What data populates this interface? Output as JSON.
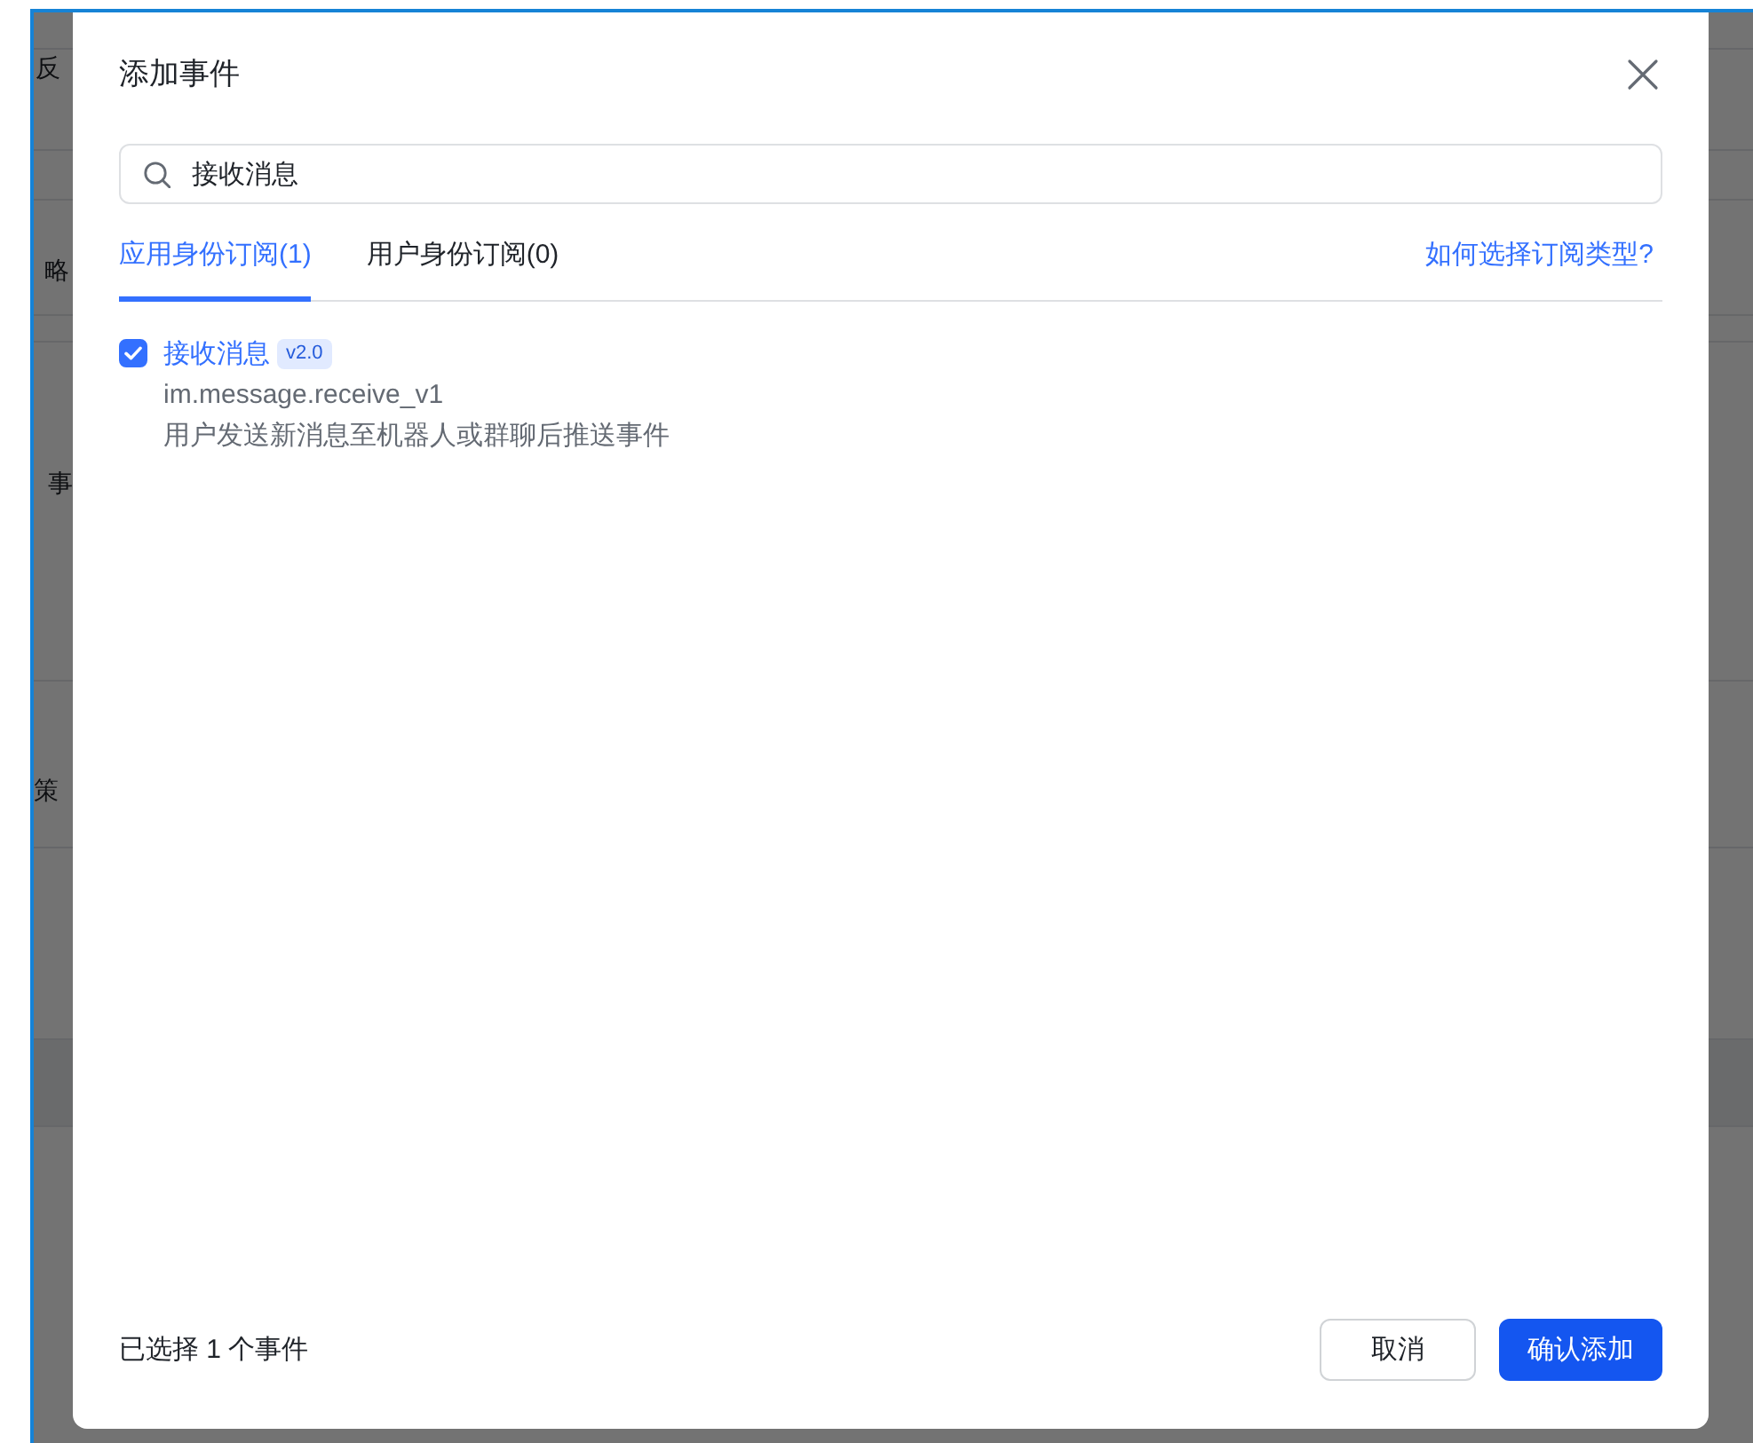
{
  "background_page": {
    "text_fragments": [
      "反",
      "略",
      "事",
      "策"
    ]
  },
  "dialog": {
    "title": "添加事件",
    "search": {
      "value": "接收消息"
    },
    "tabs": [
      {
        "label": "应用身份订阅(1)",
        "selected": true
      },
      {
        "label": "用户身份订阅(0)",
        "selected": false
      }
    ],
    "help_link": "如何选择订阅类型?",
    "events": [
      {
        "name": "接收消息",
        "version": "v2.0",
        "key": "im.message.receive_v1",
        "description": "用户发送新消息至机器人或群聊后推送事件",
        "checked": true
      }
    ],
    "footer": {
      "selection_summary": "已选择 1 个事件",
      "buttons": [
        {
          "label": "取消",
          "kind": "secondary"
        },
        {
          "label": "确认添加",
          "kind": "primary"
        }
      ]
    }
  }
}
